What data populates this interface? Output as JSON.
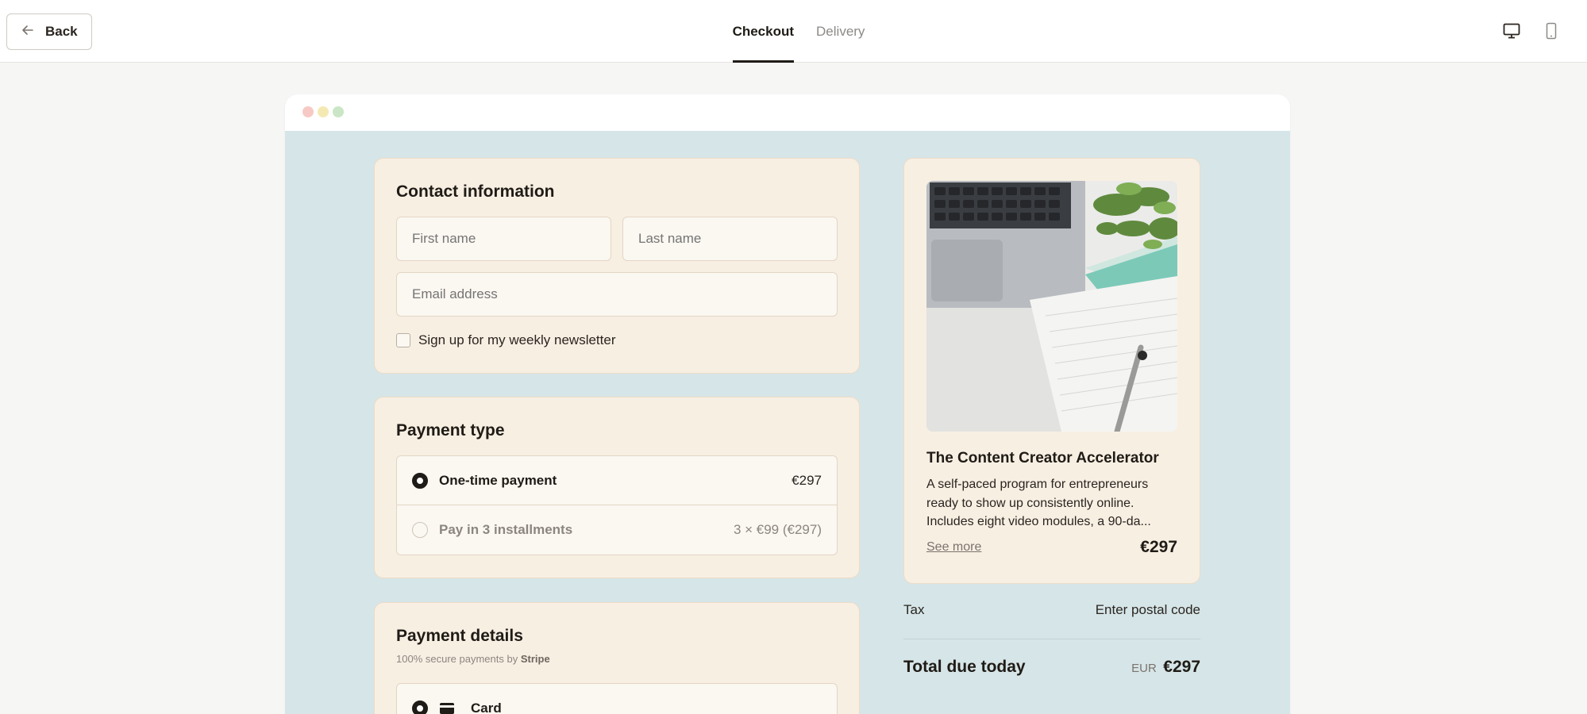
{
  "header": {
    "back_label": "Back",
    "tabs": [
      {
        "label": "Checkout",
        "active": true
      },
      {
        "label": "Delivery",
        "active": false
      }
    ],
    "icons": [
      "arrow-left-icon",
      "desktop-icon",
      "mobile-icon"
    ]
  },
  "contact": {
    "title": "Contact information",
    "first_name_placeholder": "First name",
    "last_name_placeholder": "Last name",
    "email_placeholder": "Email address",
    "newsletter_label": "Sign up for my weekly newsletter"
  },
  "payment_type": {
    "title": "Payment type",
    "options": [
      {
        "label": "One-time payment",
        "price": "€297",
        "selected": true
      },
      {
        "label": "Pay in 3 installments",
        "price": "3 × €99 (€297)",
        "selected": false
      }
    ]
  },
  "payment_details": {
    "title": "Payment details",
    "secure_prefix": "100% secure payments by",
    "secure_brand": "Stripe",
    "method_label": "Card"
  },
  "product": {
    "title": "The Content Creator Accelerator",
    "description": "A self-paced program for entrepreneurs ready to show up consistently online. Includes eight video modules, a 90-da...",
    "see_more": "See more",
    "price": "€297"
  },
  "summary": {
    "tax_label": "Tax",
    "tax_value": "Enter postal code",
    "total_label": "Total due today",
    "currency": "EUR",
    "total_value": "€297"
  },
  "colors": {
    "page_bg": "#f6f6f5",
    "canvas_bg": "#d6e5e7",
    "card_bg": "#f8efe3",
    "text": "#1f1b16",
    "accent_teal": "#7cc9b8"
  }
}
